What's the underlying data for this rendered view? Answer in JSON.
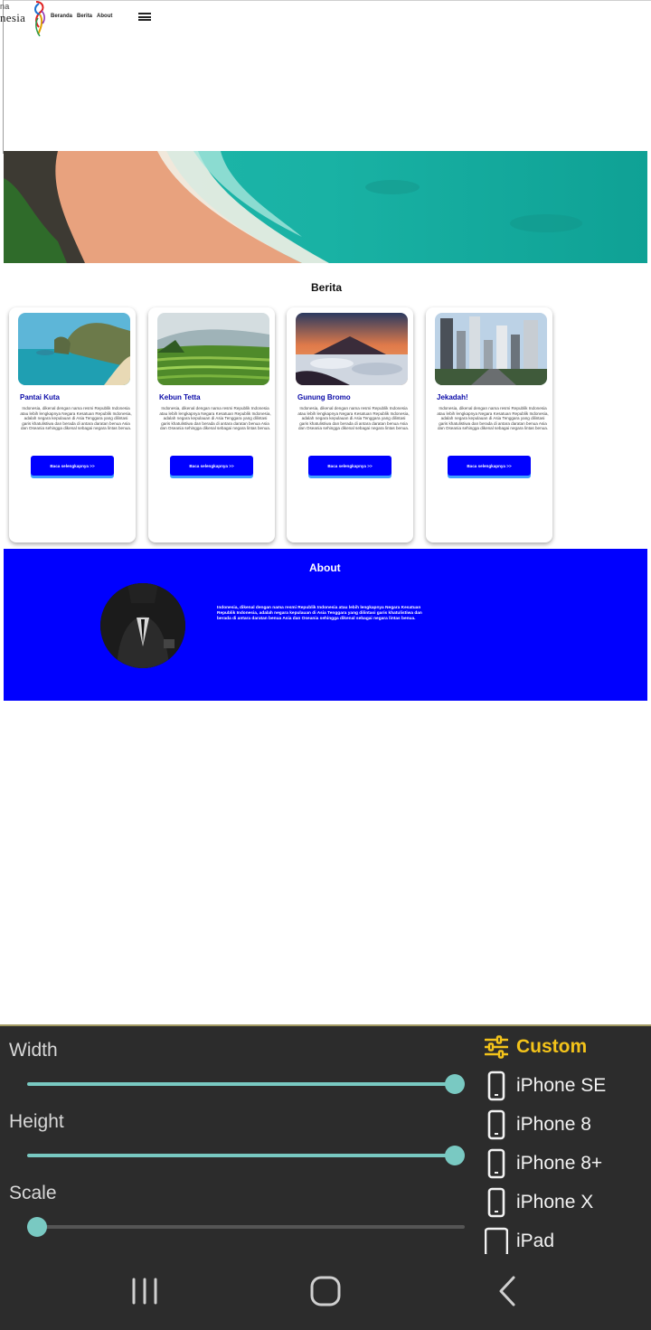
{
  "nav": {
    "logo_line1": "na",
    "logo_line2": "nesia",
    "links": [
      "Beranda",
      "Berita",
      "About"
    ]
  },
  "berita": {
    "title": "Berita",
    "cards": [
      {
        "title": "Pantai Kuta",
        "desc": "Indonesia, dikenal dengan nama resmi Republik Indonesia atau lebih lengkapnya Negara Kesatuan Republik Indonesia, adalah negara kepulauan di Asia Tenggara yang dilintasi garis khatulistiwa dan berada di antara daratan benua Asia dan Oseania sehingga dikenal sebagai negara lintas benua.",
        "button": "Baca selengkapnya >>"
      },
      {
        "title": "Kebun Tetta",
        "desc": "Indonesia, dikenal dengan nama resmi Republik Indonesia atau lebih lengkapnya Negara Kesatuan Republik Indonesia, adalah negara kepulauan di Asia Tenggara yang dilintasi garis khatulistiwa dan berada di antara daratan benua Asia dan Oseania sehingga dikenal sebagai negara lintas benua.",
        "button": "Baca selengkapnya >>"
      },
      {
        "title": "Gunung Bromo",
        "desc": "Indonesia, dikenal dengan nama resmi Republik Indonesia atau lebih lengkapnya Negara Kesatuan Republik Indonesia, adalah negara kepulauan di Asia Tenggara yang dilintasi garis khatulistiwa dan berada di antara daratan benua Asia dan Oseania sehingga dikenal sebagai negara lintas benua.",
        "button": "Baca selengkapnya >>"
      },
      {
        "title": "Jekadah!",
        "desc": "Indonesia, dikenal dengan nama resmi Republik Indonesia atau lebih lengkapnya Negara Kesatuan Republik Indonesia, adalah negara kepulauan di Asia Tenggara yang dilintasi garis khatulistiwa dan berada di antara daratan benua Asia dan Oseania sehingga dikenal sebagai negara lintas benua.",
        "button": "Baca selengkapnya >>"
      }
    ]
  },
  "about": {
    "title": "About",
    "text": "Indonesia, dikenal dengan nama resmi Republik Indonesia atau lebih lengkapnya Negara Kesatuan Republik Indonesia, adalah negara kepulauan di Asia Tenggara yang dilintasi garis khatulistiwa dan berada di antara daratan benua Asia dan Oseania sehingga dikenal sebagai negara lintas benua."
  },
  "panel": {
    "width_label": "Width",
    "height_label": "Height",
    "scale_label": "Scale",
    "width_value": 1.0,
    "height_value": 1.0,
    "scale_value": 0.0,
    "devices": [
      "Custom",
      "iPhone SE",
      "iPhone 8",
      "iPhone 8+",
      "iPhone X",
      "iPad"
    ],
    "active_device": "Custom"
  },
  "colors": {
    "accent": "#0000ff",
    "slider": "#79c9c2",
    "active_device": "#f3c31a",
    "panel_bg": "#2c2c2c"
  }
}
